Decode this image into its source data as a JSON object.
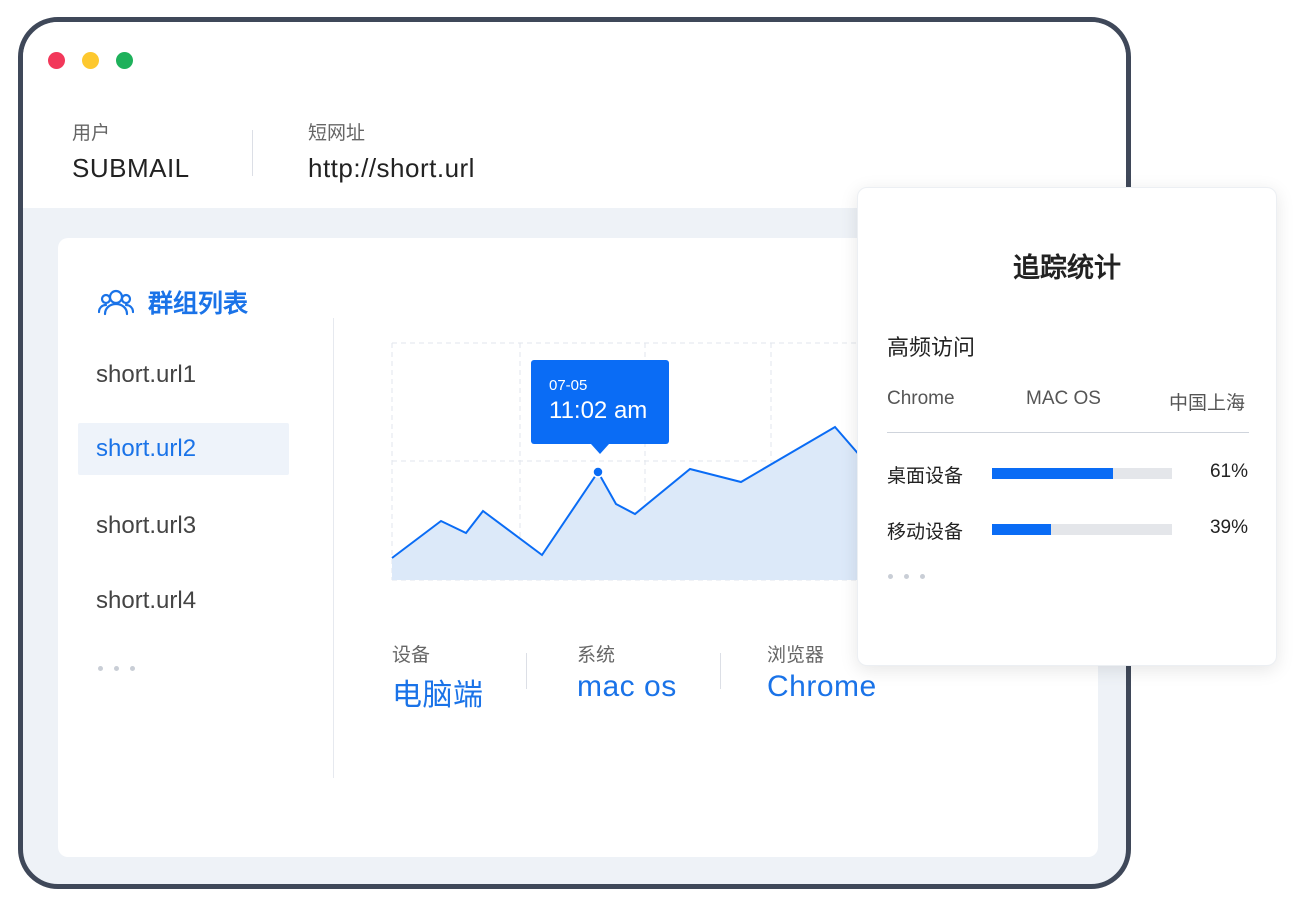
{
  "header": {
    "user_label": "用户",
    "user_value": "SUBMAIL",
    "url_label": "短网址",
    "url_value": "http://short.url"
  },
  "groups": {
    "title": "群组列表",
    "items": [
      "short.url1",
      "short.url2",
      "short.url3",
      "short.url4"
    ],
    "active_index": 1
  },
  "tooltip": {
    "date": "07-05",
    "time": "11:02 am"
  },
  "stats": [
    {
      "label": "设备",
      "value": "电脑端"
    },
    {
      "label": "系统",
      "value": "mac os"
    },
    {
      "label": "浏览器",
      "value": "Chrome"
    }
  ],
  "panel": {
    "title": "追踪统计",
    "subtitle": "高频访问",
    "columns": [
      "Chrome",
      "MAC OS",
      "中国上海"
    ],
    "devices": [
      {
        "label": "桌面设备",
        "percent_text": "61%",
        "fraction": 0.67
      },
      {
        "label": "移动设备",
        "percent_text": "39%",
        "fraction": 0.33
      }
    ]
  },
  "colors": {
    "accent": "#0a6cf5",
    "frame": "#3f4859",
    "area_fill": "#dce9f9"
  },
  "icons": [
    "close-dot",
    "minimize-dot",
    "maximize-dot",
    "users-icon"
  ]
}
